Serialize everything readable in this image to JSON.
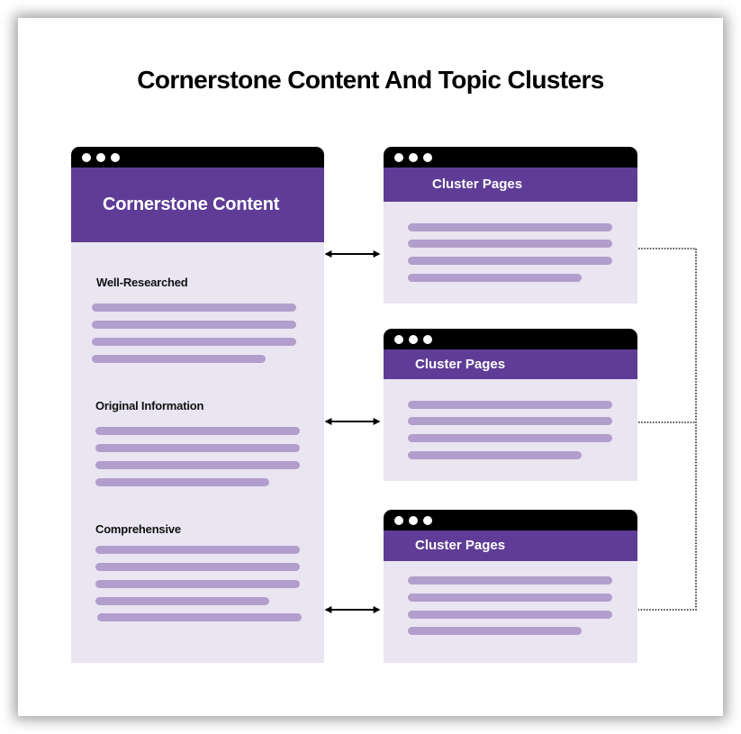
{
  "title": "Cornerstone Content And Topic Clusters",
  "colors": {
    "titlebar": "#000000",
    "header": "#5f3d96",
    "body": "#e9e5f1",
    "bar": "#b29ecc"
  },
  "main_window": {
    "header": "Cornerstone Content",
    "window_controls": [
      "dot",
      "dot",
      "dot"
    ],
    "sections": [
      {
        "label": "Well-Researched",
        "lines": [
          1,
          1,
          1,
          0.85
        ]
      },
      {
        "label": "Original Information",
        "lines": [
          1,
          1,
          1,
          0.85
        ]
      },
      {
        "label": "Comprehensive",
        "lines": [
          1,
          1,
          1,
          0.85,
          1
        ]
      }
    ]
  },
  "cluster_windows": [
    {
      "header": "Cluster Pages",
      "lines": [
        1,
        1,
        1,
        0.85
      ]
    },
    {
      "header": "Cluster Pages",
      "lines": [
        1,
        1,
        1,
        0.85
      ]
    },
    {
      "header": "Cluster Pages",
      "lines": [
        1,
        1,
        1,
        0.85
      ]
    }
  ],
  "connections": [
    {
      "from": "main_window",
      "to": "cluster_windows.0",
      "type": "bidirectional-arrow"
    },
    {
      "from": "main_window",
      "to": "cluster_windows.1",
      "type": "bidirectional-arrow"
    },
    {
      "from": "main_window",
      "to": "cluster_windows.2",
      "type": "bidirectional-arrow"
    },
    {
      "from": "cluster_windows.0",
      "to": "cluster_windows.2",
      "type": "dotted-bracket",
      "via": "cluster_windows.1"
    }
  ]
}
